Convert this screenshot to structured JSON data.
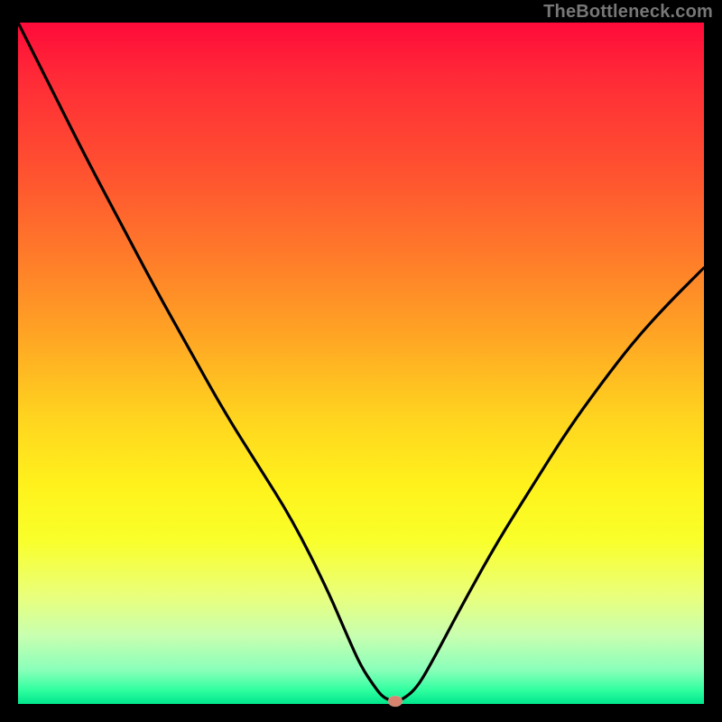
{
  "watermark": "TheBottleneck.com",
  "chart_data": {
    "type": "line",
    "title": "",
    "xlabel": "",
    "ylabel": "",
    "xlim": [
      0,
      100
    ],
    "ylim": [
      0,
      100
    ],
    "grid": false,
    "x": [
      0,
      5,
      10,
      15,
      20,
      25,
      30,
      35,
      40,
      45,
      48,
      50,
      52,
      53,
      54,
      55,
      56,
      58,
      60,
      65,
      70,
      75,
      80,
      85,
      90,
      95,
      100
    ],
    "values": [
      100,
      90,
      80,
      70.5,
      61,
      52,
      43,
      35,
      27,
      17,
      10,
      5.5,
      2.5,
      1.2,
      0.6,
      0.4,
      0.6,
      2.2,
      5.5,
      15,
      24,
      32,
      40,
      47,
      53.5,
      59,
      64
    ],
    "marker": {
      "x": 55,
      "y": 0.4
    },
    "gradient_stops": [
      {
        "pos": 0,
        "color": "#ff0a3a"
      },
      {
        "pos": 8,
        "color": "#ff2a37"
      },
      {
        "pos": 22,
        "color": "#ff5230"
      },
      {
        "pos": 34,
        "color": "#ff7a2a"
      },
      {
        "pos": 46,
        "color": "#ffa524"
      },
      {
        "pos": 58,
        "color": "#ffd41f"
      },
      {
        "pos": 68,
        "color": "#fff21c"
      },
      {
        "pos": 76,
        "color": "#f9ff2a"
      },
      {
        "pos": 84,
        "color": "#eaff7a"
      },
      {
        "pos": 90,
        "color": "#c8ffb0"
      },
      {
        "pos": 95,
        "color": "#8affba"
      },
      {
        "pos": 98,
        "color": "#2fffa0"
      },
      {
        "pos": 100,
        "color": "#00e58c"
      }
    ],
    "colors": {
      "curve": "#000000",
      "marker": "#d6846f",
      "page_bg": "#000000"
    }
  }
}
